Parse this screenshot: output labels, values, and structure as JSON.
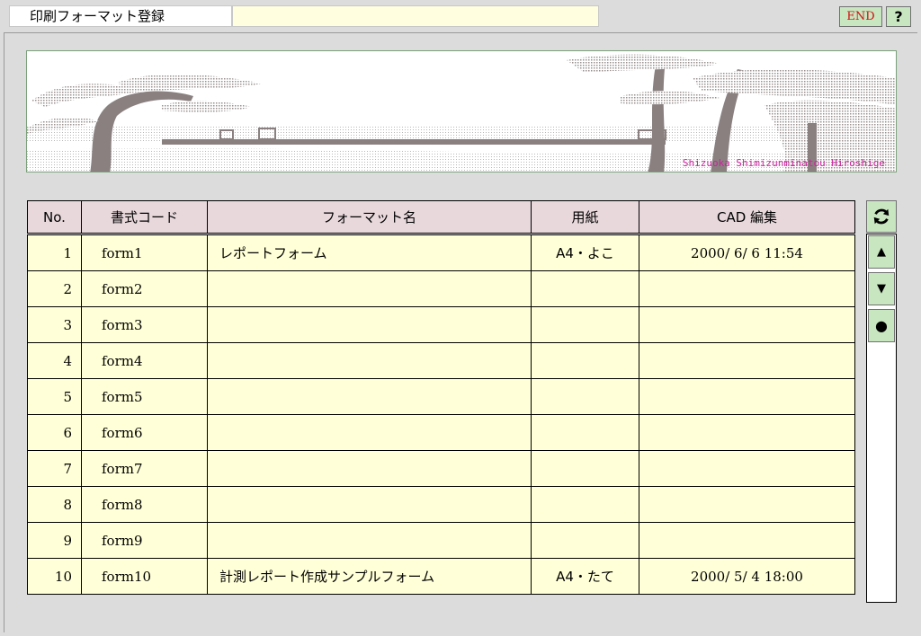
{
  "window": {
    "title": "印刷フォーマット登録",
    "end_label": "END",
    "help_label": "?"
  },
  "banner": {
    "credit": "Shizuoka Shimizunminatou Hiroshige"
  },
  "table": {
    "headers": [
      "No.",
      "書式コード",
      "フォーマット名",
      "用紙",
      "CAD 編集"
    ],
    "rows": [
      [
        "1",
        "form1",
        "レポートフォーム",
        "A4・よこ",
        "2000/ 6/ 6 11:54"
      ],
      [
        "2",
        "form2",
        "",
        "",
        ""
      ],
      [
        "3",
        "form3",
        "",
        "",
        ""
      ],
      [
        "4",
        "form4",
        "",
        "",
        ""
      ],
      [
        "5",
        "form5",
        "",
        "",
        ""
      ],
      [
        "6",
        "form6",
        "",
        "",
        ""
      ],
      [
        "7",
        "form7",
        "",
        "",
        ""
      ],
      [
        "8",
        "form8",
        "",
        "",
        ""
      ],
      [
        "9",
        "form9",
        "",
        "",
        ""
      ],
      [
        "10",
        "form10",
        "計測レポート作成サンプルフォーム",
        "A4・たて",
        "2000/ 5/ 4 18:00"
      ]
    ]
  },
  "sidebar": {
    "refresh_icon": "refresh-icon",
    "up_icon": "triangle-up-icon",
    "down_icon": "triangle-down-icon",
    "select_icon": "dot-icon"
  }
}
